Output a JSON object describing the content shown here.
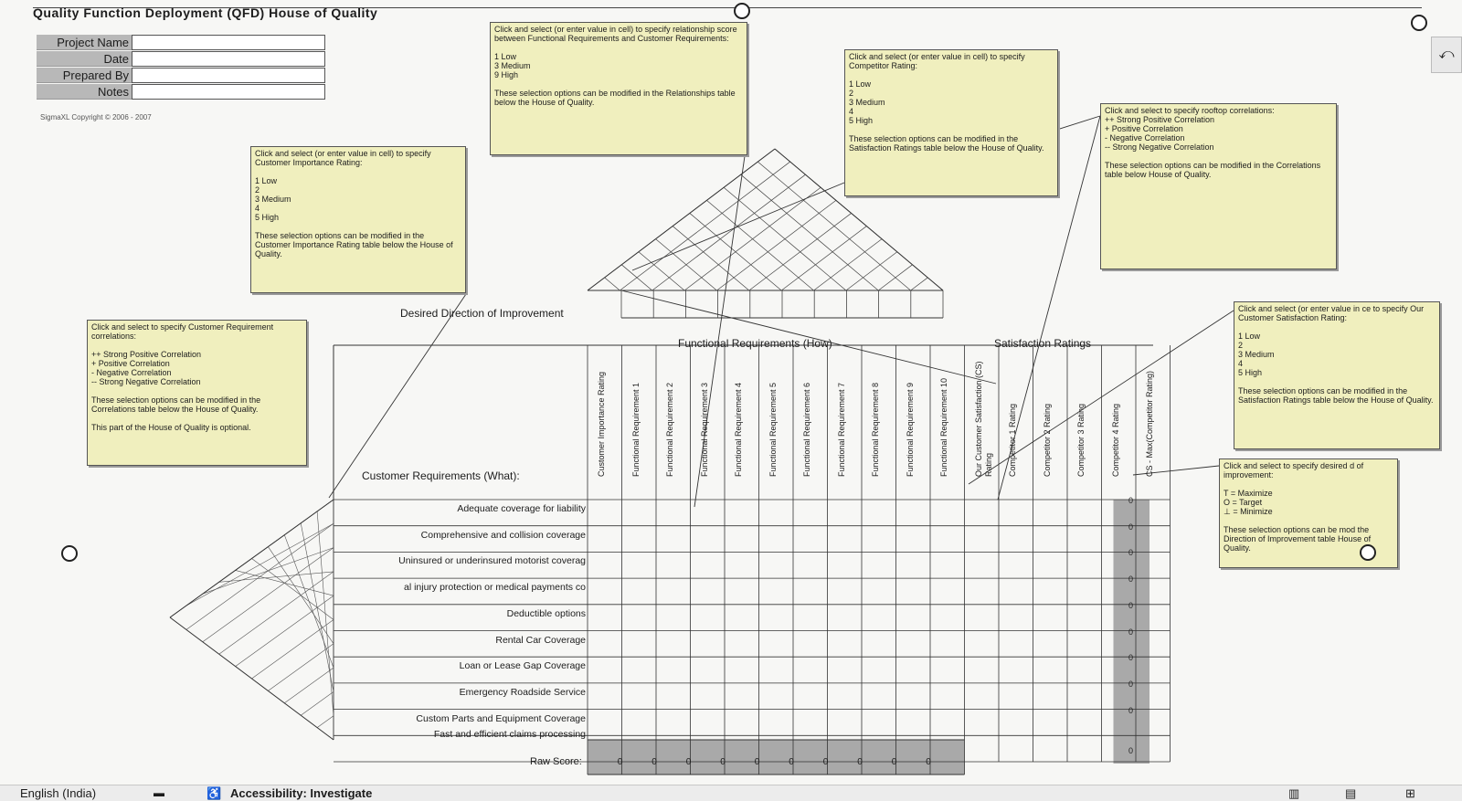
{
  "title": "Quality Function Deployment (QFD) House of Quality",
  "info_fields": [
    "Project Name",
    "Date",
    "Prepared By",
    "Notes"
  ],
  "copyright": "SigmaXL Copyright © 2006 - 2007",
  "notes": {
    "relationship": "Click and select (or enter value in cell) to specify relationship score between Functional Requirements and Customer Requirements:\n\n1 Low\n3 Medium\n9 High\n\nThese selection options can be modified in the Relationships table below the House of Quality.",
    "competitor": "Click and select (or enter value in cell) to specify Competitor Rating:\n\n1 Low\n2\n3 Medium\n4\n5 High\n\nThese selection options can be modified in the Satisfaction Ratings table below the House of Quality.",
    "rooftop": "Click and select to specify rooftop correlations:\n++ Strong Positive Correlation\n+ Positive Correlation\n- Negative Correlation\n-- Strong Negative Correlation\n\nThese selection options can be modified in the Correlations table below House of Quality.",
    "importance": "Click and select (or enter value in cell) to specify Customer Importance Rating:\n\n1 Low\n2\n3 Medium\n4\n5 High\n\nThese selection options can be modified in the Customer Importance Rating table below the House of Quality.",
    "customer_corr": "Click and select to specify Customer Requirement correlations:\n\n++ Strong Positive Correlation\n+ Positive Correlation\n- Negative Correlation\n-- Strong Negative Correlation\n\nThese selection options can be modified in the Correlations table below the House of Quality.\n\nThis part of the House of Quality is optional.",
    "our_satisfaction": "Click and select (or enter value in ce to specify Our Customer Satisfaction Rating:\n\n1 Low\n2\n3 Medium\n4\n5 High\n\nThese selection options can be modified in the Satisfaction Ratings table below the House of Quality.",
    "direction": "Click and select to specify desired d of improvement:\n\nT = Maximize\nO = Target\n⊥ = Minimize\n\nThese selection options can be mod the Direction of Improvement table House of Quality."
  },
  "headings": {
    "direction": "Desired Direction of Improvement",
    "functional": "Functional Requirements (How)",
    "satisfaction": "Satisfaction Ratings",
    "customer_req": "Customer Requirements (What):",
    "raw_score": "Raw Score:"
  },
  "columns": [
    "Customer Importance Rating",
    "Functional Requirement 1",
    "Functional Requirement 2",
    "Functional Requirement 3",
    "Functional Requirement 4",
    "Functional Requirement 5",
    "Functional Requirement 6",
    "Functional Requirement 7",
    "Functional Requirement 8",
    "Functional Requirement 9",
    "Functional Requirement 10",
    "Our Customer Satisfaction (CS) Rating",
    "Competitor 1 Rating",
    "Competitor 2 Rating",
    "Competitor 3 Rating",
    "Competitor 4 Rating",
    "CS - Max(Competitor Rating)"
  ],
  "rows": [
    "Adequate coverage for liability",
    "Comprehensive and collision coverage",
    "Uninsured or underinsured motorist coverag",
    "al injury protection or medical payments co",
    "Deductible options",
    "Rental Car Coverage",
    "Loan or Lease Gap Coverage",
    "Emergency Roadside Service",
    "Custom Parts and Equipment Coverage",
    "Fast and efficient claims processing"
  ],
  "cs_diff_values": [
    "0",
    "0",
    "0",
    "0",
    "0",
    "0",
    "0",
    "0",
    "0",
    "0"
  ],
  "raw_scores": [
    "0",
    "0",
    "0",
    "0",
    "0",
    "0",
    "0",
    "0",
    "0",
    "0"
  ],
  "status": {
    "language": "English (India)",
    "accessibility": "Accessibility: Investigate"
  },
  "colors": {
    "note_bg": "#f0efbe",
    "gray_cells": "#a9a9a9",
    "label_bg": "#b8b8b8"
  }
}
